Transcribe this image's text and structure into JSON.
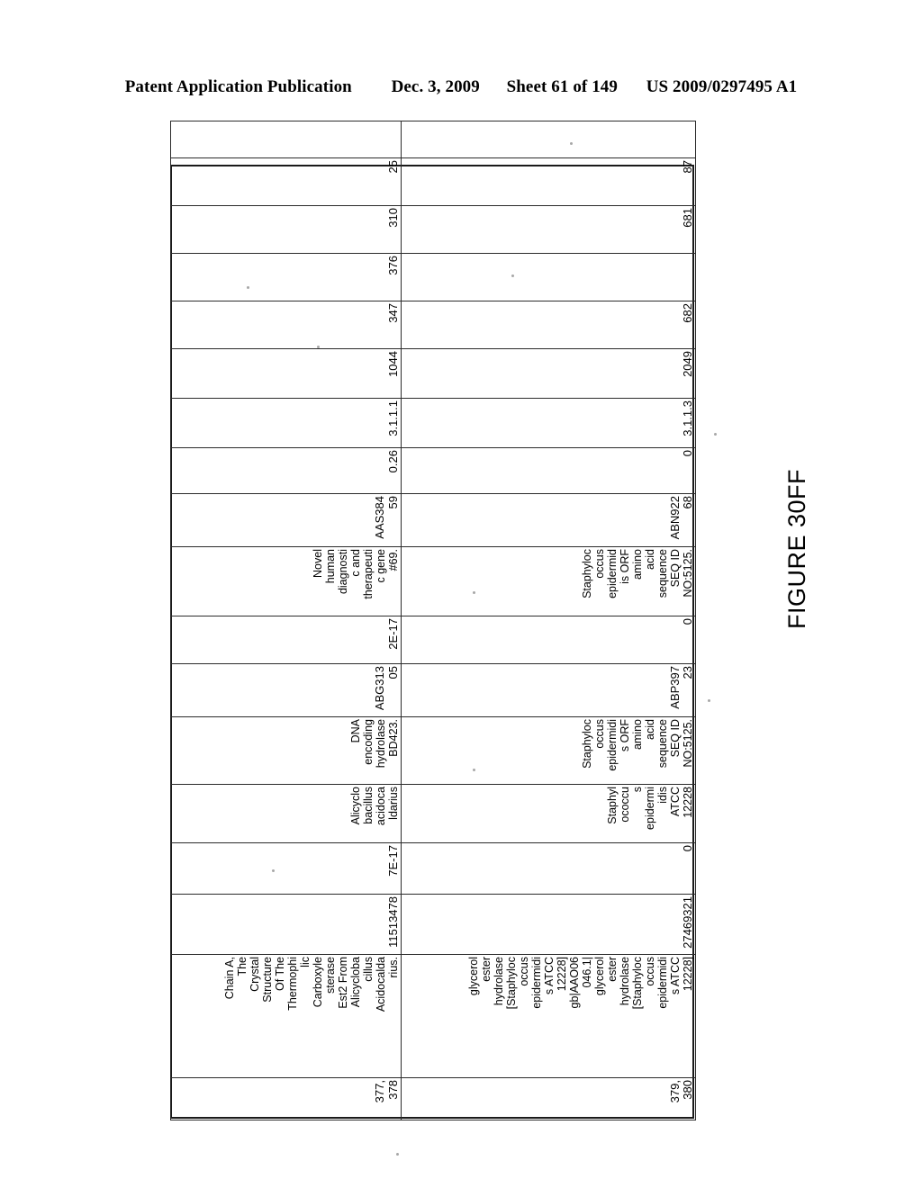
{
  "header": {
    "publication": "Patent Application Publication",
    "date": "Dec. 3, 2009",
    "sheet": "Sheet 61 of 149",
    "patent_number": "US 2009/0297495 A1"
  },
  "figure": {
    "caption": "FIGURE 30FF"
  },
  "table": {
    "rows": [
      {
        "index_numbers": "377,\n378",
        "description": "Chain A,\nThe\nCrystal\nStructure\nOf The\nThermophi\nlic\nCarboxyle\nsterase\nEst2 From\nAlicycloba\ncillus\nAcidocalda\nrius.",
        "accession": "11513478",
        "evalue_1": "7E-17",
        "organism": "Alicyclo\nbacillus\nacidoca\nldarius",
        "patent_title": "DNA\nencoding\nhydrolase\nBD423.",
        "patent_accession": "ABG313\n05",
        "evalue_2": "2E-17",
        "patent_title_2": "Novel\nhuman\ndiagnosti\nc and\ntherapeuti\nc gene\n#69.",
        "patent_accession_2": "AAS384\n59",
        "score": "0.26",
        "ec_number": "3.1.1.1",
        "num_1": "1044",
        "num_2": "347",
        "num_3": "376",
        "num_4": "310",
        "num_5": "25"
      },
      {
        "index_numbers": "379,\n380",
        "description": "glycerol\nester\nhydrolase\n[Staphyloc\noccus\nepidermidi\ns ATCC\n12228]\ngb|AAO06\n046.1|\nglycerol\nester\nhydrolase\n[Staphyloc\noccus\nepidermidi\ns ATCC\n12228]",
        "accession": "27469321",
        "evalue_1": "0",
        "organism": "Staphyl\nococcu\ns\nepidermi\nidis\nATCC\n12228",
        "patent_title": "Staphyloc\noccus\nepidermidi\ns ORF\namino\nacid\nsequence\nSEQ ID\nNO:5125.",
        "patent_accession": "ABP397\n23",
        "evalue_2": "0",
        "patent_title_2": "Staphyloc\noccus\nepidermid\nis ORF\namino\nacid\nsequence\nSEQ ID\nNO:5125.",
        "patent_accession_2": "ABN922\n68",
        "score": "0",
        "ec_number": "3.1.1.3",
        "num_1": "2049",
        "num_2": "682",
        "num_3": "",
        "num_4": "681",
        "num_5": "87"
      }
    ]
  }
}
